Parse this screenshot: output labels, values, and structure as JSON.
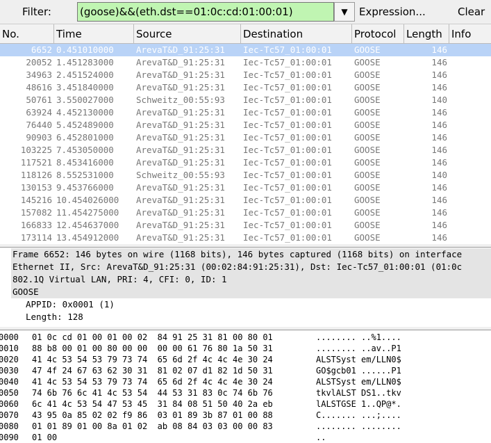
{
  "filter": {
    "label": "Filter:",
    "value": "(goose)&&(eth.dst==01:0c:cd:01:00:01)",
    "expression": "Expression...",
    "clear": "Clear"
  },
  "columns": [
    "No.",
    "Time",
    "Source",
    "Destination",
    "Protocol",
    "Length",
    "Info"
  ],
  "packets": [
    [
      "6652",
      "0.451010000",
      "ArevaT&D_91:25:31",
      "Iec-Tc57_01:00:01",
      "GOOSE",
      "146"
    ],
    [
      "20052",
      "1.451283000",
      "ArevaT&D_91:25:31",
      "Iec-Tc57_01:00:01",
      "GOOSE",
      "146"
    ],
    [
      "34963",
      "2.451524000",
      "ArevaT&D_91:25:31",
      "Iec-Tc57_01:00:01",
      "GOOSE",
      "146"
    ],
    [
      "48616",
      "3.451840000",
      "ArevaT&D_91:25:31",
      "Iec-Tc57_01:00:01",
      "GOOSE",
      "146"
    ],
    [
      "50761",
      "3.550027000",
      "Schweitz_00:55:93",
      "Iec-Tc57_01:00:01",
      "GOOSE",
      "140"
    ],
    [
      "63924",
      "4.452130000",
      "ArevaT&D_91:25:31",
      "Iec-Tc57_01:00:01",
      "GOOSE",
      "146"
    ],
    [
      "76440",
      "5.452489000",
      "ArevaT&D_91:25:31",
      "Iec-Tc57_01:00:01",
      "GOOSE",
      "146"
    ],
    [
      "90903",
      "6.452801000",
      "ArevaT&D_91:25:31",
      "Iec-Tc57_01:00:01",
      "GOOSE",
      "146"
    ],
    [
      "103225",
      "7.453050000",
      "ArevaT&D_91:25:31",
      "Iec-Tc57_01:00:01",
      "GOOSE",
      "146"
    ],
    [
      "117521",
      "8.453416000",
      "ArevaT&D_91:25:31",
      "Iec-Tc57_01:00:01",
      "GOOSE",
      "146"
    ],
    [
      "118126",
      "8.552531000",
      "Schweitz_00:55:93",
      "Iec-Tc57_01:00:01",
      "GOOSE",
      "140"
    ],
    [
      "130153",
      "9.453766000",
      "ArevaT&D_91:25:31",
      "Iec-Tc57_01:00:01",
      "GOOSE",
      "146"
    ],
    [
      "145216",
      "10.454026000",
      "ArevaT&D_91:25:31",
      "Iec-Tc57_01:00:01",
      "GOOSE",
      "146"
    ],
    [
      "157082",
      "11.454275000",
      "ArevaT&D_91:25:31",
      "Iec-Tc57_01:00:01",
      "GOOSE",
      "146"
    ],
    [
      "166833",
      "12.454637000",
      "ArevaT&D_91:25:31",
      "Iec-Tc57_01:00:01",
      "GOOSE",
      "146"
    ],
    [
      "173114",
      "13.454912000",
      "ArevaT&D_91:25:31",
      "Iec-Tc57_01:00:01",
      "GOOSE",
      "146"
    ]
  ],
  "details": [
    {
      "text": "Frame 6652: 146 bytes on wire (1168 bits), 146 bytes captured (1168 bits) on interface",
      "level": 0,
      "expanded": false
    },
    {
      "text": "Ethernet II, Src: ArevaT&D_91:25:31 (00:02:84:91:25:31), Dst: Iec-Tc57_01:00:01 (01:0c",
      "level": 0,
      "expanded": false
    },
    {
      "text": "802.1Q Virtual LAN, PRI: 4, CFI: 0, ID: 1",
      "level": 0,
      "expanded": false
    },
    {
      "text": "GOOSE",
      "level": 0,
      "expanded": true
    },
    {
      "text": "APPID: 0x0001 (1)",
      "level": 1
    },
    {
      "text": "Length: 128",
      "level": 1
    }
  ],
  "hex": [
    [
      "0000",
      "01 0c cd 01 00 01 00 02  84 91 25 31 81 00 80 01",
      "........ ..%1...."
    ],
    [
      "0010",
      "88 b8 00 01 00 80 00 00  00 00 61 76 80 1a 50 31",
      "........ ..av..P1"
    ],
    [
      "0020",
      "41 4c 53 54 53 79 73 74  65 6d 2f 4c 4c 4e 30 24",
      "ALSTSyst em/LLN0$"
    ],
    [
      "0030",
      "47 4f 24 67 63 62 30 31  81 02 07 d1 82 1d 50 31",
      "GO$gcb01 ......P1"
    ],
    [
      "0040",
      "41 4c 53 54 53 79 73 74  65 6d 2f 4c 4c 4e 30 24",
      "ALSTSyst em/LLN0$"
    ],
    [
      "0050",
      "74 6b 76 6c 41 4c 53 54  44 53 31 83 0c 74 6b 76",
      "tkvlALST DS1..tkv"
    ],
    [
      "0060",
      "6c 41 4c 53 54 47 53 45  31 84 08 51 50 40 2a eb",
      "lALSTGSE 1..QP@*."
    ],
    [
      "0070",
      "43 95 0a 85 02 02 f9 86  03 01 89 3b 87 01 00 88",
      "C....... ...;...."
    ],
    [
      "0080",
      "01 01 89 01 00 8a 01 02  ab 08 84 03 03 00 00 83",
      "........ ........"
    ],
    [
      "0090",
      "01 00",
      "..                "
    ]
  ]
}
